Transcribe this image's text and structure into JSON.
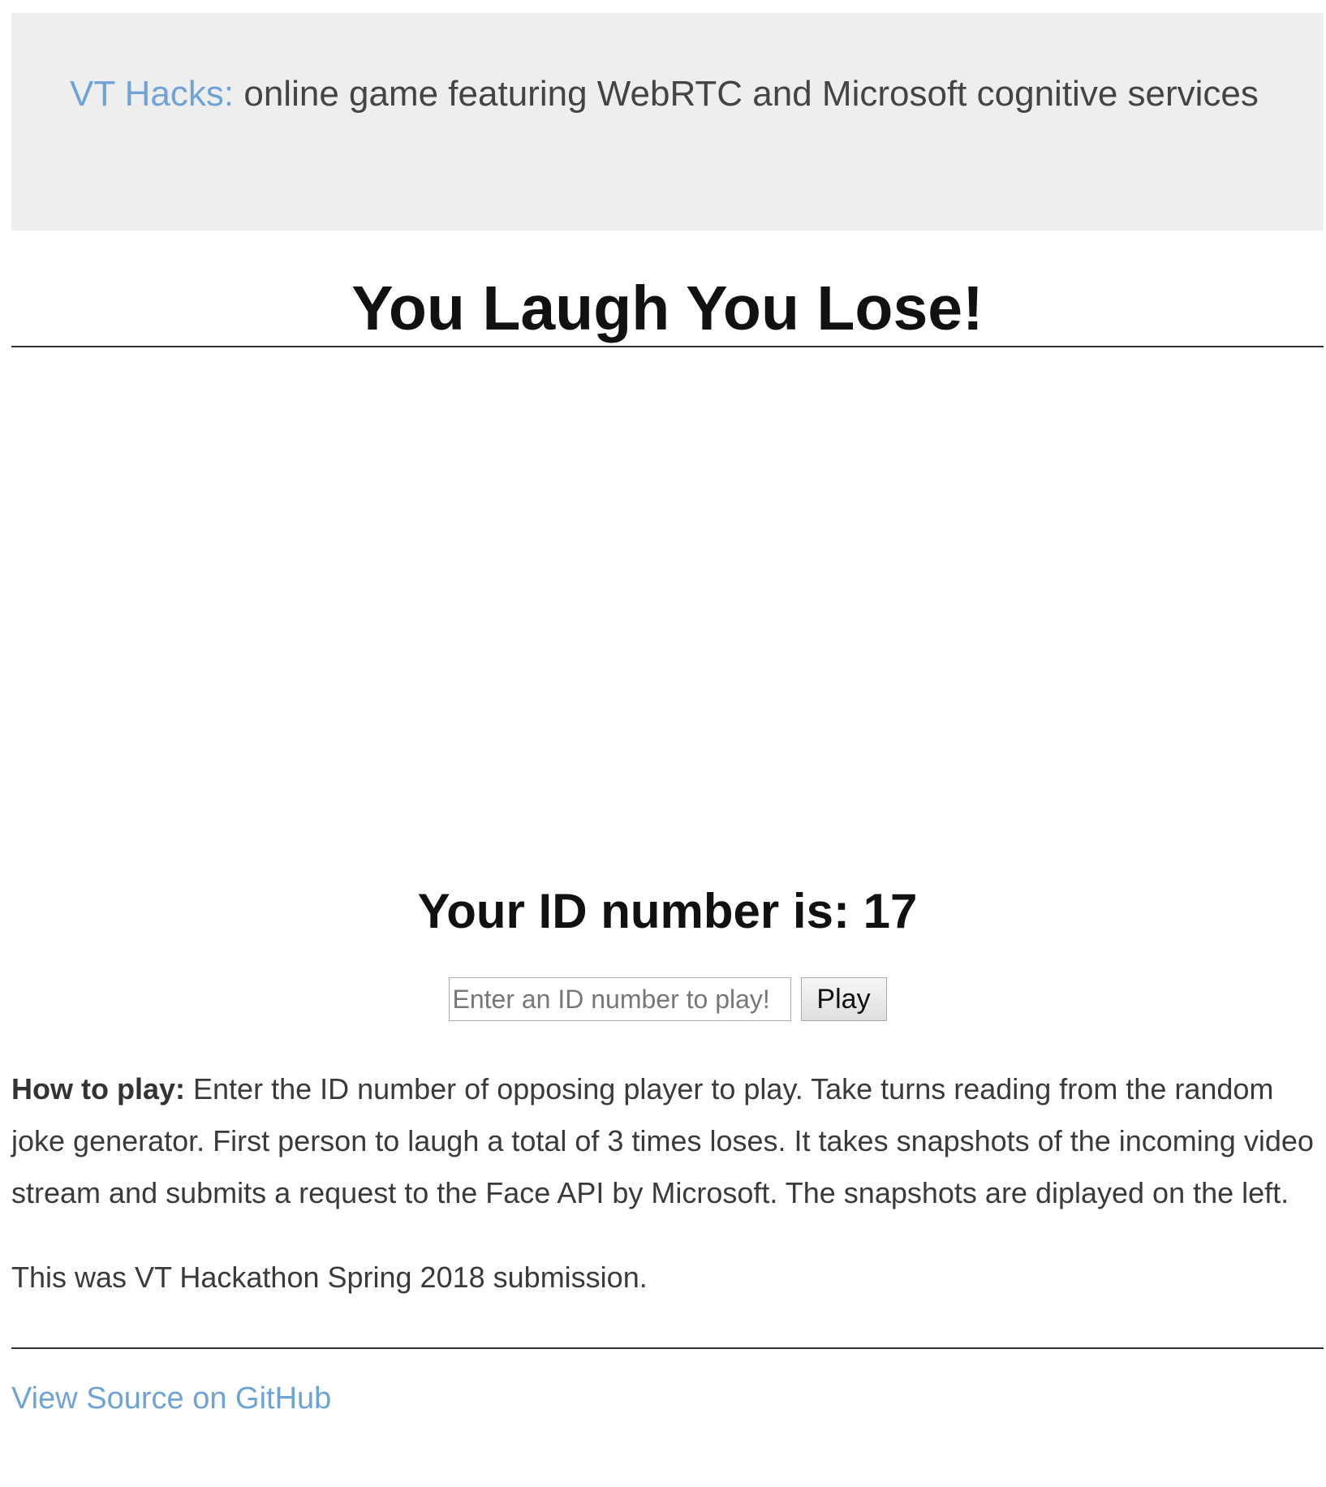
{
  "header": {
    "link_text": "VT Hacks:",
    "description": "online game featuring WebRTC and Microsoft cognitive services"
  },
  "game": {
    "title": "You Laugh You Lose!",
    "id_label": "Your ID number is: 17"
  },
  "play_form": {
    "input_placeholder": "Enter an ID number to play!",
    "input_value": "",
    "play_label": "Play"
  },
  "instructions": {
    "label": "How to play:",
    "text": "Enter the ID number of opposing player to play. Take turns reading from the random joke generator. First person to laugh a total of 3 times loses. It takes snapshots of the incoming video stream and submits a request to the Face API by Microsoft. The snapshots are diplayed on the left."
  },
  "credit": {
    "text": "This was VT Hackathon Spring 2018 submission."
  },
  "footer": {
    "github_link": "View Source on GitHub"
  },
  "colors": {
    "link": "#6fa3d6",
    "header_bg": "#eeeeee",
    "text": "#3a3a3a"
  }
}
